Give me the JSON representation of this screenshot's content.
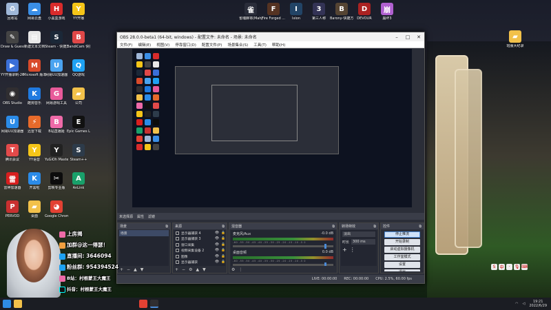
{
  "desktop_icons_left": [
    {
      "label": "回收站",
      "color": "#9fb7d8",
      "glyph": "♻"
    },
    {
      "label": "网易云盘",
      "color": "#3a8ee6",
      "glyph": "☁"
    },
    {
      "label": "小黑盒游戏",
      "color": "#d82b2b",
      "glyph": "H"
    },
    {
      "label": "YY开播",
      "color": "#f5c518",
      "glyph": "Y"
    },
    {
      "label": "Draw & Guess",
      "color": "#444",
      "glyph": "✎"
    },
    {
      "label": "新建文本文档",
      "color": "#e8e8e8",
      "glyph": "▤"
    },
    {
      "label": "Steam - 快捷方式",
      "color": "#1b2838",
      "glyph": "S"
    },
    {
      "label": "BandiCam 快捷方式",
      "color": "#e04848",
      "glyph": "B"
    },
    {
      "label": "YY开播录制-20...",
      "color": "#3a6fd8",
      "glyph": "▶"
    },
    {
      "label": "Microsoft 版本-快捷方式",
      "color": "#d84a2a",
      "glyph": "M"
    },
    {
      "label": "网易UU加速器",
      "color": "#4aa3f0",
      "glyph": "U"
    },
    {
      "label": "QQ游戏",
      "color": "#1ea1f2",
      "glyph": "Q"
    },
    {
      "label": "OBS Studio",
      "color": "#302e31",
      "glyph": "◉"
    },
    {
      "label": "酷狗音乐",
      "color": "#1f7ae0",
      "glyph": "K"
    },
    {
      "label": "网易游戏工具",
      "color": "#e85a9a",
      "glyph": "G"
    },
    {
      "label": "公司",
      "color": "#f2c14a",
      "glyph": "▰"
    },
    {
      "label": "网易UU加速器",
      "color": "#2b8be8",
      "glyph": "U"
    },
    {
      "label": "迅雷下载",
      "color": "#e86a2a",
      "glyph": "⚡"
    },
    {
      "label": "B站直播姬",
      "color": "#ee6aa8",
      "glyph": "B"
    },
    {
      "label": "Epic Games Launcher",
      "color": "#111",
      "glyph": "E"
    },
    {
      "label": "腾讯会议",
      "color": "#e24a4a",
      "glyph": "T"
    },
    {
      "label": "YY语音",
      "color": "#f5c518",
      "glyph": "Y"
    },
    {
      "label": "YuGiOh Master",
      "color": "#222",
      "glyph": "Y"
    },
    {
      "label": "Steam++",
      "color": "#2d3b4a",
      "glyph": "S"
    },
    {
      "label": "雷神加速器",
      "color": "#d81f1f",
      "glyph": "雷"
    },
    {
      "label": "开黑啦",
      "color": "#2b8be8",
      "glyph": "K"
    },
    {
      "label": "剪映专业版",
      "color": "#0c0c0c",
      "glyph": "✂"
    },
    {
      "label": "AnLink",
      "color": "#19a06a",
      "glyph": "A"
    },
    {
      "label": "PERVOD",
      "color": "#c83030",
      "glyph": "P"
    },
    {
      "label": "桌面",
      "color": "#f2c14a",
      "glyph": "▰"
    },
    {
      "label": "Google Chrome",
      "color": "#e34133",
      "glyph": "◕"
    }
  ],
  "desktop_icons_top": [
    {
      "label": "雀魂麻将(Mahjong...",
      "color": "#2a2d3a",
      "glyph": "雀"
    },
    {
      "label": "Fire Forged ...",
      "color": "#553322",
      "glyph": "F"
    },
    {
      "label": "Ixion",
      "color": "#224466",
      "glyph": "I"
    },
    {
      "label": "第三人称",
      "color": "#333355",
      "glyph": "3"
    },
    {
      "label": "Barony-快捷方式",
      "color": "#554433",
      "glyph": "B"
    },
    {
      "label": "DEVOUR",
      "color": "#aa2222",
      "glyph": "D"
    },
    {
      "label": "崩坏3",
      "color": "#b060d0",
      "glyph": "崩"
    }
  ],
  "right_folder": {
    "label": "班服大纪录",
    "color": "#f2c14a"
  },
  "obs": {
    "title": "OBS 28.0.0-beta1 (64-bit, windows) - 配置文件: 未命名 - 场景: 未命名",
    "menu": [
      "文件(F)",
      "编辑(E)",
      "视图(V)",
      "停靠窗口(D)",
      "配置文件(P)",
      "场景集合(S)",
      "工具(T)",
      "帮助(H)"
    ],
    "scene_bar_label": "未选择源",
    "scene_bar_btn1": "属性",
    "scene_bar_btn2": "滤镜",
    "docks": {
      "scenes": {
        "title": "场景",
        "items": [
          "场景"
        ]
      },
      "sources": {
        "title": "来源",
        "items": [
          {
            "label": "显示器捕获 4"
          },
          {
            "label": "显示器捕获 3"
          },
          {
            "label": "窗口采集"
          },
          {
            "label": "视频采集设备 2"
          },
          {
            "label": "图像"
          },
          {
            "label": "显示器捕获"
          },
          {
            "label": "显示器采集"
          }
        ]
      },
      "mixer": {
        "title": "混音器",
        "channels": [
          {
            "name": "麦克风/Aux",
            "db": "-0.0 dB",
            "ticks": "-60 -55 -50 -45 -40 -35 -30 -25 -20 -15 -10 -5 0"
          },
          {
            "name": "桌面音频",
            "db": "0.0 dB",
            "ticks": "-60 -55 -50 -45 -40 -35 -30 -25 -20 -15 -10 -5 0"
          }
        ]
      },
      "transitions": {
        "title": "转场特效",
        "transition": "淡出",
        "duration_label": "时长",
        "duration_value": "300 ms"
      },
      "controls": {
        "title": "控件",
        "buttons": [
          {
            "label": "停止推流",
            "active": true
          },
          {
            "label": "开始录制",
            "active": false
          },
          {
            "label": "启动虚拟摄像机",
            "active": false
          },
          {
            "label": "工作室模式",
            "active": false
          },
          {
            "label": "设置",
            "active": false
          },
          {
            "label": "退出",
            "active": false
          }
        ]
      }
    },
    "status": {
      "live": "LIVE: 00:00:00",
      "rec": "REC: 00:00:00",
      "cpu": "CPU: 2.5%, 60.00 fps"
    }
  },
  "overlay": {
    "name": "上房揭",
    "fans": "加群@这一得瑟！",
    "qq_group": "直播间: 3646094",
    "group2": "粉丝群: 954394524",
    "tag1": "B站：村根蒙王大魔王",
    "tag2": "抖音：村根蒙王大魔王"
  },
  "taskbar": {
    "time": "19:21",
    "date": "2022/6/29"
  },
  "ime": [
    "S",
    "中",
    "·",
    "🎙",
    "⌨"
  ]
}
